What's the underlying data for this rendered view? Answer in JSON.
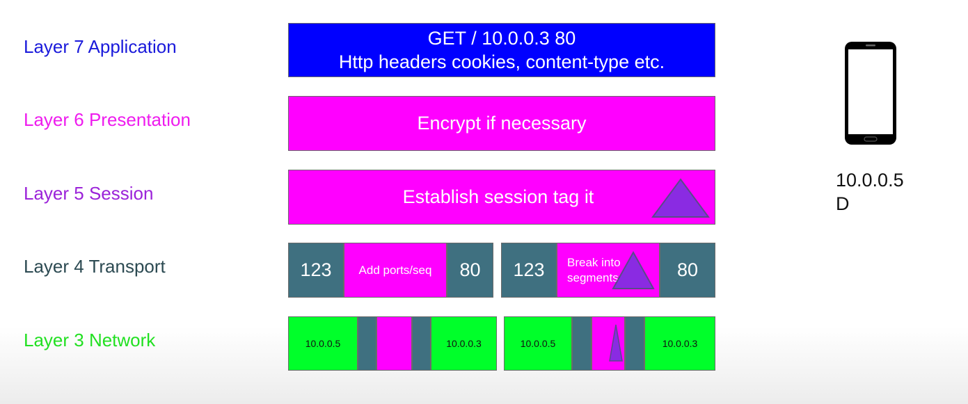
{
  "layers": {
    "l7": {
      "label": "Layer 7 Application",
      "color": "#1a1adb",
      "line1": "GET / 10.0.0.3 80",
      "line2": "Http headers cookies, content-type etc."
    },
    "l6": {
      "label": "Layer 6 Presentation",
      "color": "#ee1cee",
      "text": "Encrypt if necessary"
    },
    "l5": {
      "label": "Layer 5 Session",
      "color": "#9b23d9",
      "text": "Establish session tag it"
    },
    "l4": {
      "label": "Layer 4 Transport",
      "color": "#2c4a52",
      "seg1": {
        "src_port": "123",
        "text": "Add ports/seq",
        "dst_port": "80"
      },
      "seg2": {
        "src_port": "123",
        "text_line1": "Break into",
        "text_line2": "segments",
        "dst_port": "80"
      }
    },
    "l3": {
      "label": "Layer 3 Network",
      "color": "#22e022",
      "pkt1": {
        "src_ip": "10.0.0.5",
        "dst_ip": "10.0.0.3"
      },
      "pkt2": {
        "src_ip": "10.0.0.5",
        "dst_ip": "10.0.0.3"
      }
    }
  },
  "device": {
    "icon": "smartphone-icon",
    "ip": "10.0.0.5",
    "tag": "D"
  },
  "colors": {
    "blue": "#0000ff",
    "magenta": "#ff00ff",
    "teal": "#3f7080",
    "green": "#00ff2a",
    "purple": "#8a2be2"
  }
}
